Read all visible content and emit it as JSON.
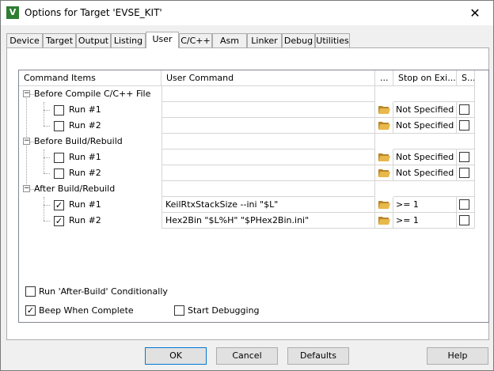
{
  "window": {
    "title": "Options for Target 'EVSE_KIT'",
    "icon_letter": "V",
    "close_glyph": "✕"
  },
  "tabs": [
    {
      "label": "Device"
    },
    {
      "label": "Target"
    },
    {
      "label": "Output"
    },
    {
      "label": "Listing"
    },
    {
      "label": "User",
      "active": true
    },
    {
      "label": "C/C++"
    },
    {
      "label": "Asm"
    },
    {
      "label": "Linker"
    },
    {
      "label": "Debug"
    },
    {
      "label": "Utilities"
    }
  ],
  "grid": {
    "headers": {
      "command_items": "Command Items",
      "user_command": "User Command",
      "dots": "...",
      "stop_on_exit": "Stop on Exi...",
      "s": "S..."
    },
    "groups": [
      {
        "label": "Before Compile C/C++ File",
        "expander": "−",
        "runs": [
          {
            "label": "Run #1",
            "checked": false,
            "command": "",
            "stop": "Not Specified"
          },
          {
            "label": "Run #2",
            "checked": false,
            "command": "",
            "stop": "Not Specified"
          }
        ]
      },
      {
        "label": "Before Build/Rebuild",
        "expander": "−",
        "runs": [
          {
            "label": "Run #1",
            "checked": false,
            "command": "",
            "stop": "Not Specified"
          },
          {
            "label": "Run #2",
            "checked": false,
            "command": "",
            "stop": "Not Specified"
          }
        ]
      },
      {
        "label": "After Build/Rebuild",
        "expander": "−",
        "runs": [
          {
            "label": "Run #1",
            "checked": true,
            "command": "KeilRtxStackSize --ini \"$L\"",
            "stop": ">= 1"
          },
          {
            "label": "Run #2",
            "checked": true,
            "command": "Hex2Bin \"$L%H\" \"$PHex2Bin.ini\"",
            "stop": ">= 1"
          }
        ]
      }
    ]
  },
  "options": {
    "run_after_build": {
      "label": "Run 'After-Build' Conditionally",
      "checked": false
    },
    "beep_when_complete": {
      "label": "Beep When Complete",
      "checked": true
    },
    "start_debugging": {
      "label": "Start Debugging",
      "checked": false
    }
  },
  "check_glyph": "✓",
  "buttons": {
    "ok": "OK",
    "cancel": "Cancel",
    "defaults": "Defaults",
    "help": "Help"
  },
  "colors": {
    "folder": "#e8b84a",
    "folder_dark": "#b8862a",
    "app_icon": "#2e7d32"
  }
}
